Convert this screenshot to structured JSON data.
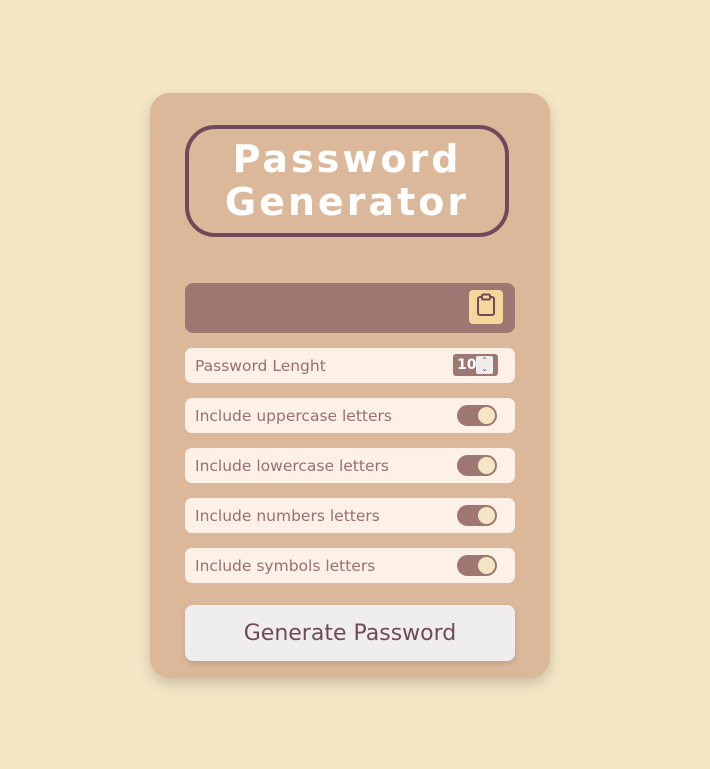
{
  "title": {
    "line1": "Password",
    "line2": "Generator"
  },
  "output": {
    "value": "",
    "copy_icon": "clipboard-icon"
  },
  "options": {
    "length": {
      "label": "Password Lenght",
      "value": "10"
    },
    "uppercase": {
      "label": "Include uppercase letters",
      "checked": true
    },
    "lowercase": {
      "label": "Include lowercase letters",
      "checked": true
    },
    "numbers": {
      "label": "Include numbers letters",
      "checked": true
    },
    "symbols": {
      "label": "Include symbols letters",
      "checked": true
    }
  },
  "generate_button": {
    "label": "Generate Password"
  },
  "colors": {
    "page_background": "#f5e7c6",
    "card_background": "#dcb89a",
    "accent": "#9e7672",
    "title_border": "#6e4a5a",
    "option_background": "#fdf0e6",
    "copy_button": "#f6d69c"
  }
}
